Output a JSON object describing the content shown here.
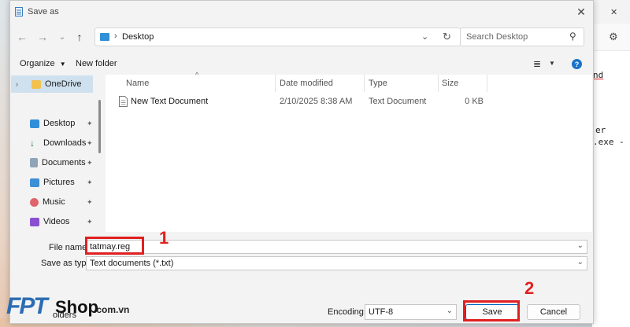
{
  "dialog": {
    "title": "Save as",
    "close_icon": "close-icon"
  },
  "nav": {
    "back_icon": "arrow-left-icon",
    "forward_icon": "arrow-right-icon",
    "recent_icon": "chevron-down-icon",
    "up_icon": "arrow-up-icon",
    "address_path": "Desktop",
    "refresh_icon": "refresh-icon",
    "search_placeholder": "Search Desktop"
  },
  "command_bar": {
    "organize_label": "Organize",
    "new_folder_label": "New folder",
    "help_icon": "help-icon"
  },
  "navigation_pane": {
    "items": [
      {
        "label": "OneDrive",
        "icon": "folder-icon",
        "selected": true
      },
      {
        "label": "Desktop",
        "icon": "desktop-icon",
        "pinned": true
      },
      {
        "label": "Downloads",
        "icon": "download-icon",
        "pinned": true
      },
      {
        "label": "Documents",
        "icon": "document-icon",
        "pinned": true
      },
      {
        "label": "Pictures",
        "icon": "pictures-icon",
        "pinned": true
      },
      {
        "label": "Music",
        "icon": "music-icon",
        "pinned": true
      },
      {
        "label": "Videos",
        "icon": "videos-icon",
        "pinned": true
      }
    ]
  },
  "file_list": {
    "columns": [
      "Name",
      "Date modified",
      "Type",
      "Size"
    ],
    "rows": [
      {
        "name": "New Text Document",
        "date_modified": "2/10/2025 8:38 AM",
        "type": "Text Document",
        "size": "0 KB"
      }
    ]
  },
  "form": {
    "file_name_label": "File name:",
    "file_name_value": "tatmay.reg",
    "save_as_type_label": "Save as type:",
    "save_as_type_value": "Text documents (*.txt)",
    "hide_folders_label": "olders",
    "encoding_label": "Encoding:",
    "encoding_value": "UTF-8",
    "save_label": "Save",
    "cancel_label": "Cancel"
  },
  "annotations": {
    "step_1": "1",
    "step_2": "2"
  },
  "background_app": {
    "fragment_1": "nd",
    "fragment_2": "er",
    "fragment_3": ".exe -"
  },
  "watermark": {
    "logo_letters": "FPT",
    "logo_shop": "Shop",
    "logo_domain": ".com.vn"
  },
  "colors": {
    "accent": "#0067c0",
    "callout": "#e02020",
    "selection": "#cfe0ee"
  }
}
